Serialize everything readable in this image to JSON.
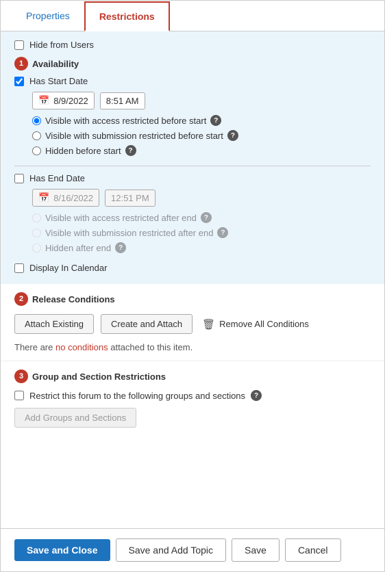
{
  "tabs": {
    "properties_label": "Properties",
    "restrictions_label": "Restrictions"
  },
  "hide_from_users": {
    "label": "Hide from Users"
  },
  "availability": {
    "section_number": "1",
    "section_label": "Availability",
    "start_date_block": {
      "checkbox_label": "Has Start Date",
      "date_value": "8/9/2022",
      "time_value": "8:51 AM",
      "radio_options": [
        {
          "label": "Visible with access restricted before start",
          "selected": true
        },
        {
          "label": "Visible with submission restricted before start",
          "selected": false
        },
        {
          "label": "Hidden before start",
          "selected": false
        }
      ]
    },
    "end_date_block": {
      "checkbox_label": "Has End Date",
      "date_value": "8/16/2022",
      "time_value": "12:51 PM",
      "radio_options": [
        {
          "label": "Visible with access restricted after end",
          "selected": false
        },
        {
          "label": "Visible with submission restricted after end",
          "selected": false
        },
        {
          "label": "Hidden after end",
          "selected": false
        }
      ]
    },
    "display_in_calendar_label": "Display In Calendar"
  },
  "release_conditions": {
    "section_number": "2",
    "section_label": "Release Conditions",
    "attach_existing_label": "Attach Existing",
    "create_and_attach_label": "Create and Attach",
    "remove_all_label": "Remove All Conditions",
    "no_conditions_text_before": "There are",
    "no_conditions_highlight": "no conditions",
    "no_conditions_text_after": "attached to this item."
  },
  "group_section_restrictions": {
    "section_number": "3",
    "section_label": "Group and Section Restrictions",
    "restrict_label": "Restrict this forum to the following groups and sections",
    "add_groups_label": "Add Groups and Sections"
  },
  "footer": {
    "save_close_label": "Save and Close",
    "save_add_topic_label": "Save and Add Topic",
    "save_label": "Save",
    "cancel_label": "Cancel"
  }
}
